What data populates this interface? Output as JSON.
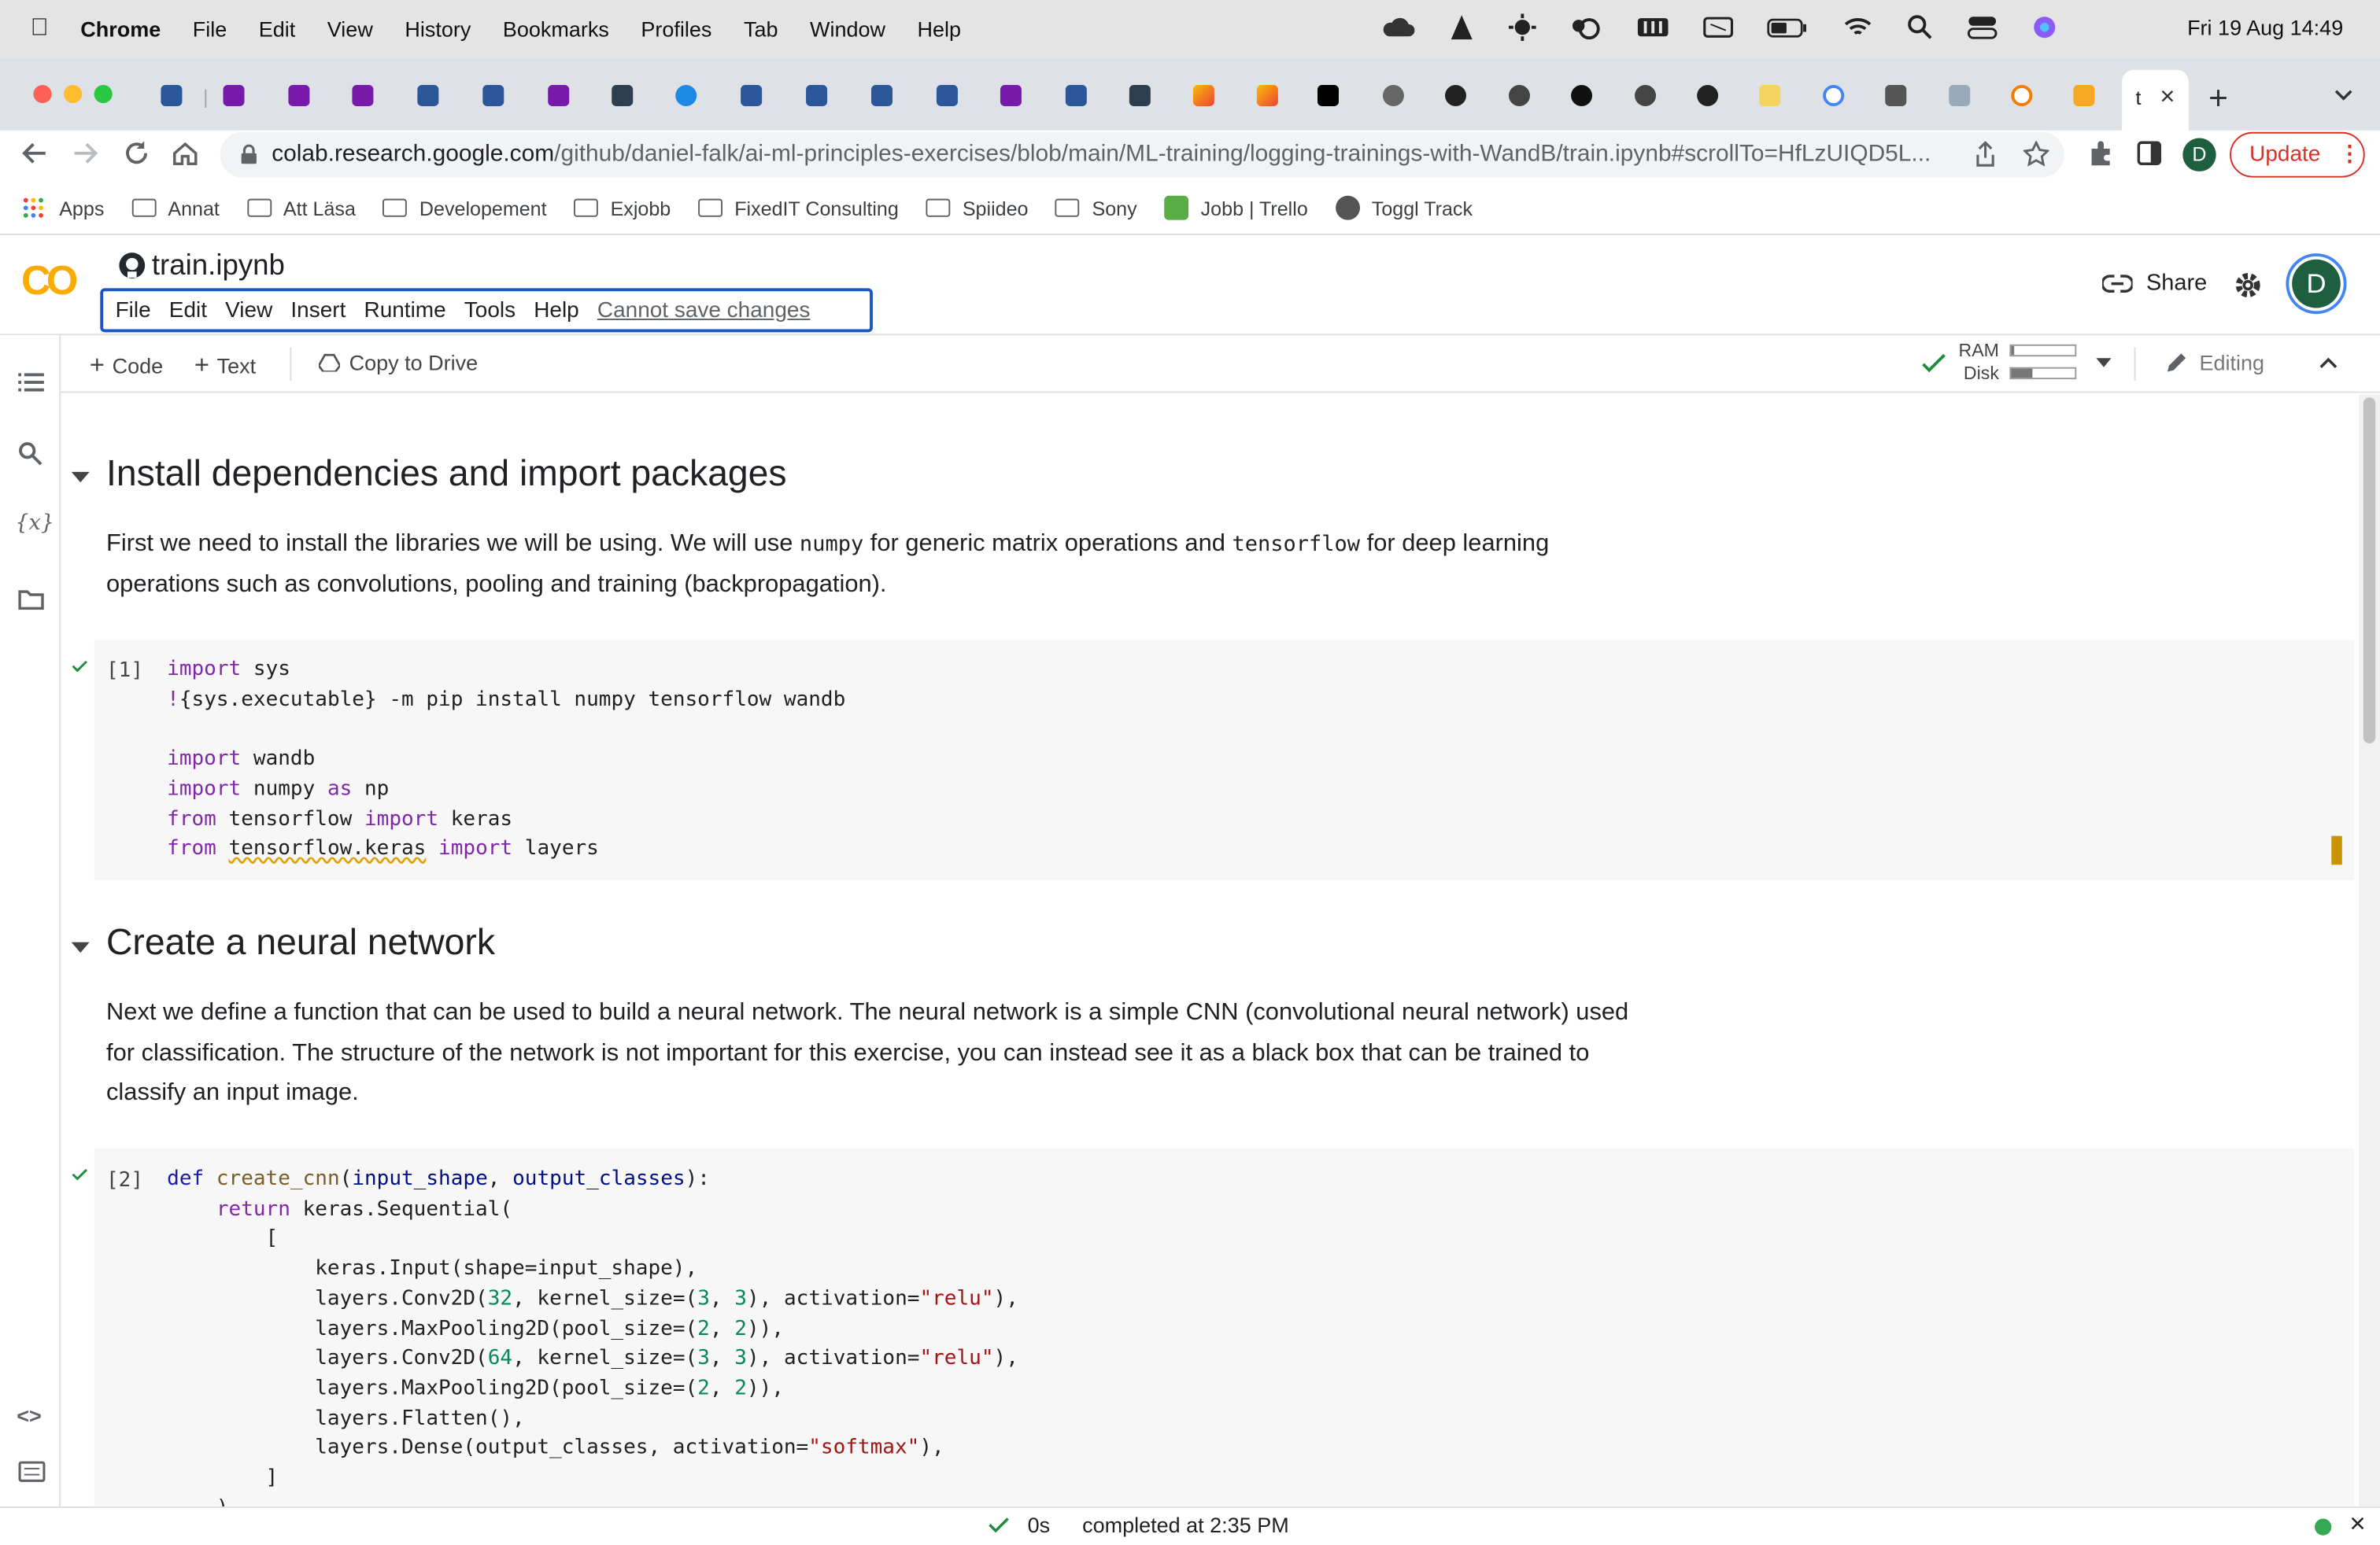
{
  "menubar": {
    "app": "Chrome",
    "items": [
      "File",
      "Edit",
      "View",
      "History",
      "Bookmarks",
      "Profiles",
      "Tab",
      "Window",
      "Help"
    ],
    "clock": "Fri 19 Aug  14:49"
  },
  "tabs": {
    "active_title": "t"
  },
  "url": {
    "host": "colab.research.google.com",
    "path": "/github/daniel-falk/ai-ml-principles-exercises/blob/main/ML-training/logging-trainings-with-WandB/train.ipynb#scrollTo=HfLzUIQD5L...",
    "update_label": "Update",
    "profile_initial": "D"
  },
  "bookmarks": [
    "Apps",
    "Annat",
    "Att Läsa",
    "Developement",
    "Exjobb",
    "FixedIT Consulting",
    "Spiideo",
    "Sony",
    "Jobb | Trello",
    "Toggl Track"
  ],
  "colab": {
    "logo": "CO",
    "filename": "train.ipynb",
    "menu": [
      "File",
      "Edit",
      "View",
      "Insert",
      "Runtime",
      "Tools",
      "Help"
    ],
    "save_status": "Cannot save changes",
    "share_label": "Share",
    "avatar_initial": "D"
  },
  "celltoolbar": {
    "add_code": "Code",
    "add_text": "Text",
    "copy_to_drive": "Copy to Drive",
    "ram_label": "RAM",
    "disk_label": "Disk",
    "mode": "Editing"
  },
  "sections": [
    {
      "heading": "Install dependencies and import packages",
      "para_parts": [
        "First we need to install the libraries we will be using. We will use ",
        "numpy",
        " for generic matrix operations and ",
        "tensorflow",
        " for deep learning",
        "operations such as convolutions, pooling and training (backpropagation)."
      ]
    },
    {
      "heading": "Create a neural network",
      "para_lines": [
        "Next we define a function that can be used to build a neural network. The neural network is a simple CNN (convolutional neural network) used",
        "for classification. The structure of the network is not important for this exercise, you can instead see it as a black box that can be trained to",
        "classify an input image."
      ]
    }
  ],
  "cells": [
    {
      "exec": "[1]"
    },
    {
      "exec": "[2]"
    }
  ],
  "status": {
    "duration": "0s",
    "completed": "completed at 2:35 PM"
  }
}
